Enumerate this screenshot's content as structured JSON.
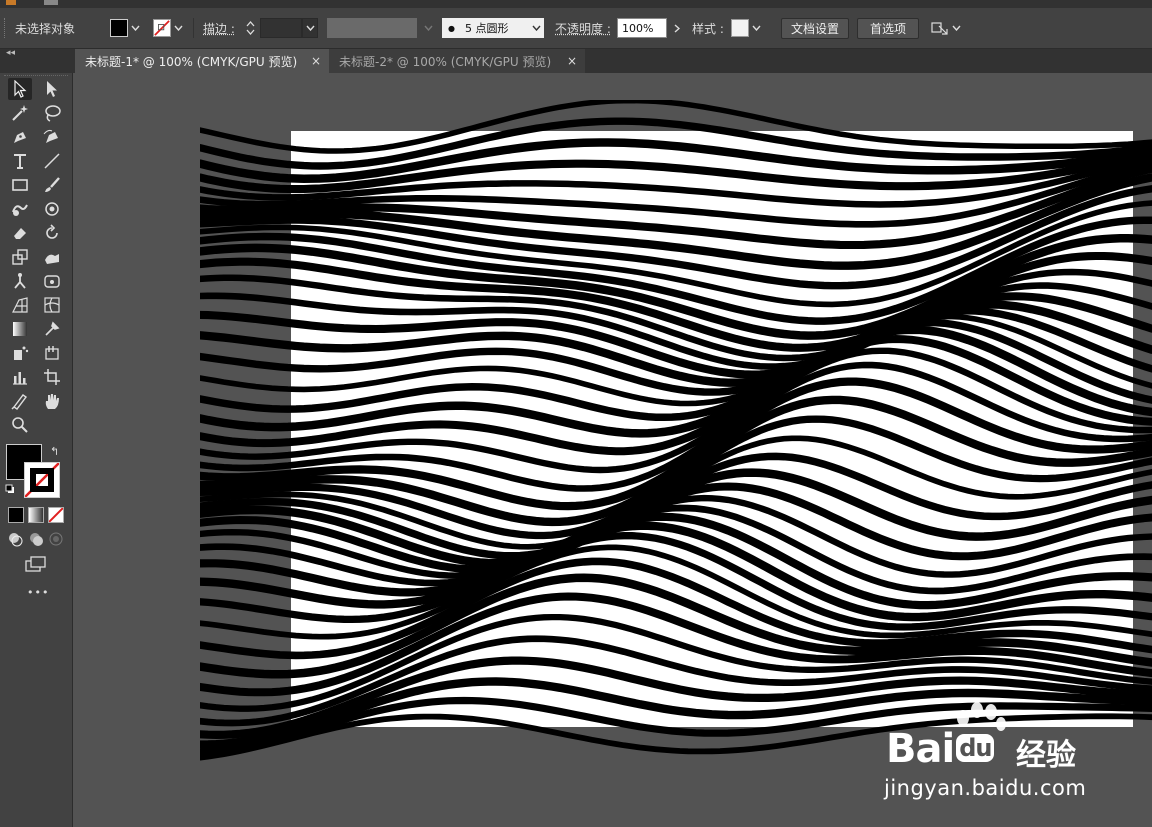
{
  "control_bar": {
    "selection_label": "未选择对象",
    "stroke_label": "描边 :",
    "brush_value": "5 点圆形",
    "opacity_label": "不透明度 :",
    "opacity_value": "100%",
    "style_label": "样式 :",
    "doc_setup_button": "文档设置",
    "preferences_button": "首选项"
  },
  "tabs": [
    {
      "label": "未标题-1* @ 100% (CMYK/GPU 预览)",
      "active": true,
      "close": "×"
    },
    {
      "label": "未标题-2* @ 100% (CMYK/GPU 预览)",
      "active": false,
      "close": "×"
    }
  ],
  "colors": {
    "fill": "#000000",
    "stroke": "none",
    "ui_dark": "#424242",
    "canvas": "#535353"
  },
  "tools_panel": {
    "more_label": "•••",
    "tools": [
      "selection-tool",
      "direct-selection-tool",
      "magic-wand-tool",
      "lasso-tool",
      "pen-tool",
      "curvature-tool",
      "type-tool",
      "line-segment-tool",
      "rectangle-tool",
      "paintbrush-tool",
      "shaper-tool",
      "blob-brush-tool",
      "eraser-tool",
      "rotate-tool",
      "scale-tool",
      "warp-tool",
      "puppet-warp-tool",
      "free-transform-tool",
      "perspective-grid-tool",
      "mesh-tool",
      "gradient-tool",
      "eyedropper-tool",
      "symbol-sprayer-tool",
      "live-paint-tool",
      "column-graph-tool",
      "artboard-tool",
      "slice-tool",
      "hand-tool",
      "zoom-tool"
    ]
  },
  "watermark": {
    "brand": "Bai",
    "brand2": "du",
    "brand_cn": "经验",
    "url": "jingyan.baidu.com"
  }
}
